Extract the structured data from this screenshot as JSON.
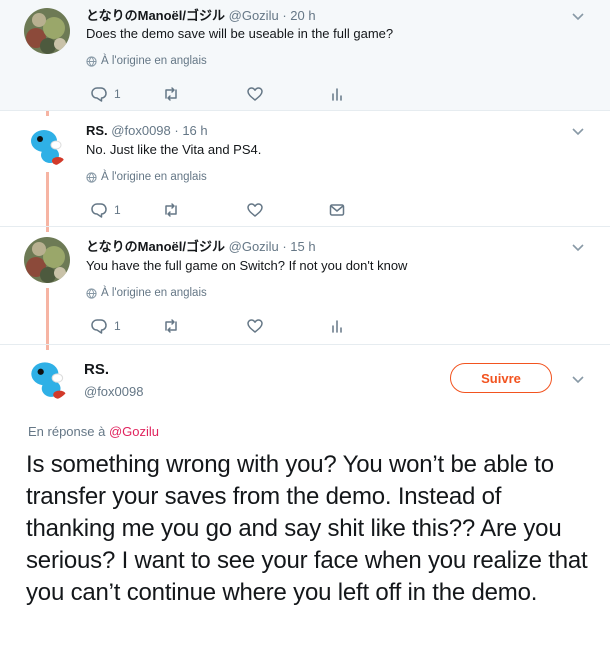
{
  "thread": [
    {
      "name": "となりのManoël/ゴジル",
      "handle": "@Gozilu",
      "time": "· 20 h",
      "text": "Does the demo save will be useable in the full game?",
      "translate_label": "À l'origine en anglais",
      "reply_count": "1",
      "retweet_count": "",
      "like_count": "",
      "extra_action": "analytics-icon"
    },
    {
      "name": "RS.",
      "handle": "@fox0098",
      "time": "· 16 h",
      "text": "No. Just like the Vita and PS4.",
      "translate_label": "À l'origine en anglais",
      "reply_count": "1",
      "retweet_count": "",
      "like_count": "",
      "extra_action": "message-icon"
    },
    {
      "name": "となりのManoël/ゴジル",
      "handle": "@Gozilu",
      "time": "· 15 h",
      "text": "You have the full game on Switch? If not you don't know",
      "translate_label": "À l'origine en anglais",
      "reply_count": "1",
      "retweet_count": "",
      "like_count": "",
      "extra_action": "analytics-icon"
    }
  ],
  "main_tweet": {
    "name": "RS.",
    "handle": "@fox0098",
    "follow_label": "Suivre",
    "reply_prefix": "En réponse à",
    "reply_mention": "@Gozilu",
    "text": "Is something wrong with you? You won’t be able to transfer your saves from the demo. Instead of thanking me you go and say shit like this?? Are you serious? I want to see your face when you realize that you can’t continue where you left off in the demo."
  },
  "colors": {
    "accent": "#f2531f",
    "thread_line": "#f6b4a3",
    "secondary_text": "#657786",
    "highlight_bg": "#f5f8fa"
  }
}
